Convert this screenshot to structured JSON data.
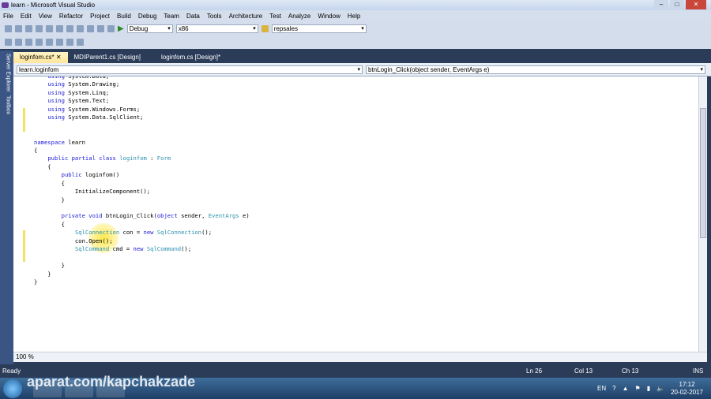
{
  "title": "learn - Microsoft Visual Studio",
  "menu": [
    "File",
    "Edit",
    "View",
    "Refactor",
    "Project",
    "Build",
    "Debug",
    "Team",
    "Data",
    "Tools",
    "Architecture",
    "Test",
    "Analyze",
    "Window",
    "Help"
  ],
  "toolbar": {
    "config": "Debug",
    "platform": "x86",
    "find": "repsales"
  },
  "side": [
    "Server Explorer",
    "Toolbox"
  ],
  "tabs": [
    "loginfom.cs*",
    "MDIParent1.cs [Design]",
    "loginfom.cs [Design]*"
  ],
  "nav": {
    "type": "learn.loginfom",
    "member": "btnLogin_Click(object sender, EventArgs e)"
  },
  "code": [
    [
      [
        "    ",
        "p"
      ],
      [
        "using",
        "k"
      ],
      [
        " System.Data;",
        "p"
      ]
    ],
    [
      [
        "    ",
        "p"
      ],
      [
        "using",
        "k"
      ],
      [
        " System.Drawing;",
        "p"
      ]
    ],
    [
      [
        "    ",
        "p"
      ],
      [
        "using",
        "k"
      ],
      [
        " System.Linq;",
        "p"
      ]
    ],
    [
      [
        "    ",
        "p"
      ],
      [
        "using",
        "k"
      ],
      [
        " System.Text;",
        "p"
      ]
    ],
    [
      [
        "    ",
        "p"
      ],
      [
        "using",
        "k"
      ],
      [
        " System.Windows.Forms;",
        "p"
      ]
    ],
    [
      [
        "    ",
        "p"
      ],
      [
        "using",
        "k"
      ],
      [
        " System.Data.SqlClient;",
        "p"
      ]
    ],
    [],
    [],
    [
      [
        "namespace",
        "k"
      ],
      [
        " learn",
        "p"
      ]
    ],
    [
      [
        "{",
        "p"
      ]
    ],
    [
      [
        "    ",
        "p"
      ],
      [
        "public partial class",
        "k"
      ],
      [
        " ",
        "p"
      ],
      [
        "loginfom",
        "t"
      ],
      [
        " : ",
        "p"
      ],
      [
        "Form",
        "t"
      ]
    ],
    [
      [
        "    {",
        "p"
      ]
    ],
    [
      [
        "        ",
        "p"
      ],
      [
        "public",
        "k"
      ],
      [
        " loginfom()",
        "p"
      ]
    ],
    [
      [
        "        {",
        "p"
      ]
    ],
    [
      [
        "            InitializeComponent();",
        "p"
      ]
    ],
    [
      [
        "        }",
        "p"
      ]
    ],
    [],
    [
      [
        "        ",
        "p"
      ],
      [
        "private void",
        "k"
      ],
      [
        " btnLogin_Click(",
        "p"
      ],
      [
        "object",
        "k"
      ],
      [
        " sender, ",
        "p"
      ],
      [
        "EventArgs",
        "t"
      ],
      [
        " e)",
        "p"
      ]
    ],
    [
      [
        "        {",
        "p"
      ]
    ],
    [
      [
        "            ",
        "p"
      ],
      [
        "SqlConnection",
        "t"
      ],
      [
        " con = ",
        "p"
      ],
      [
        "new",
        "k"
      ],
      [
        " ",
        "p"
      ],
      [
        "SqlConnection",
        "t"
      ],
      [
        "();",
        "p"
      ]
    ],
    [
      [
        "            con.Open();",
        "p"
      ]
    ],
    [
      [
        "            ",
        "p"
      ],
      [
        "SqlCommand",
        "t"
      ],
      [
        " cmd = ",
        "p"
      ],
      [
        "new",
        "k"
      ],
      [
        " ",
        "p"
      ],
      [
        "SqlCommand",
        "t"
      ],
      [
        "();",
        "p"
      ]
    ],
    [],
    [
      [
        "        }",
        "p"
      ]
    ],
    [
      [
        "    }",
        "p"
      ]
    ],
    [
      [
        "}",
        "p"
      ]
    ]
  ],
  "zoom": "100 %",
  "status": {
    "ready": "Ready",
    "ln": "Ln 26",
    "col": "Col 13",
    "ch": "Ch 13",
    "mode": "INS"
  },
  "tray": {
    "lang": "EN",
    "time": "17:12",
    "date": "20-02-2017"
  },
  "watermark": "aparat.com/kapchakzade"
}
